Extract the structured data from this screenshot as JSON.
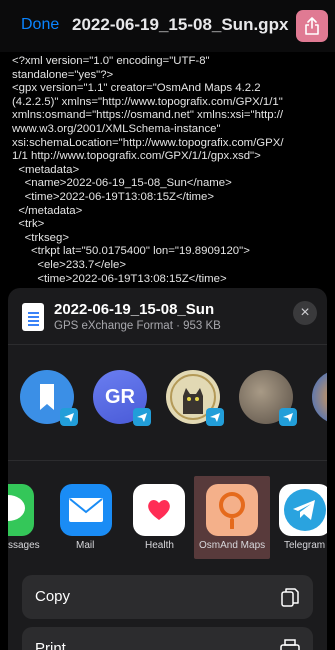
{
  "viewer": {
    "done_label": "Done",
    "title": "2022-06-19_15-08_Sun.gpx",
    "xml_lines": [
      "<?xml version=\"1.0\" encoding=\"UTF-8\"",
      "standalone=\"yes\"?>",
      "<gpx version=\"1.1\" creator=\"OsmAnd Maps 4.2.2",
      "(4.2.2.5)\" xmlns=\"http://www.topografix.com/GPX/1/1\"",
      "xmlns:osmand=\"https://osmand.net\" xmlns:xsi=\"http://",
      "www.w3.org/2001/XMLSchema-instance\"",
      "xsi:schemaLocation=\"http://www.topografix.com/GPX/",
      "1/1 http://www.topografix.com/GPX/1/1/gpx.xsd\">",
      "  <metadata>",
      "    <name>2022-06-19_15-08_Sun</name>",
      "    <time>2022-06-19T13:08:15Z</time>",
      "  </metadata>",
      "  <trk>",
      "    <trkseg>",
      "      <trkpt lat=\"50.0175400\" lon=\"19.8909120\">",
      "        <ele>233.7</ele>",
      "        <time>2022-06-19T13:08:15Z</time>"
    ]
  },
  "sheet": {
    "file_name": "2022-06-19_15-08_Sun",
    "file_meta": "GPS eXchange Format · 953 KB",
    "contacts": [
      {
        "initials": "",
        "name": "",
        "color": "#2e8ce8"
      },
      {
        "initials": "GR",
        "name": "",
        "color": "#5b6ee8"
      },
      {
        "initials": "",
        "name": "",
        "color": "#d8cfa8"
      },
      {
        "initials": "",
        "name": "",
        "color": "#6d6458"
      },
      {
        "initials": "",
        "name": "",
        "color": "#e07a2a"
      }
    ],
    "apps": [
      {
        "label": "Messages",
        "visible_label": "ssages",
        "color": "#34c759"
      },
      {
        "label": "Mail",
        "visible_label": "Mail",
        "color": "#1a8cf5"
      },
      {
        "label": "Health",
        "visible_label": "Health",
        "color": "#ffffff"
      },
      {
        "label": "OsmAnd Maps",
        "visible_label": "OsmAnd Maps",
        "color": "#f4b08a"
      },
      {
        "label": "Telegram",
        "visible_label": "Telegram",
        "color": "#ffffff"
      }
    ],
    "actions": [
      {
        "label": "Copy",
        "icon": "copy-icon"
      },
      {
        "label": "Print",
        "icon": "print-icon"
      }
    ]
  },
  "colors": {
    "accent": "#0a84ff",
    "share_button": "#e07a93",
    "sheet_bg": "#1b1b1d",
    "highlight": "#8b5454"
  }
}
